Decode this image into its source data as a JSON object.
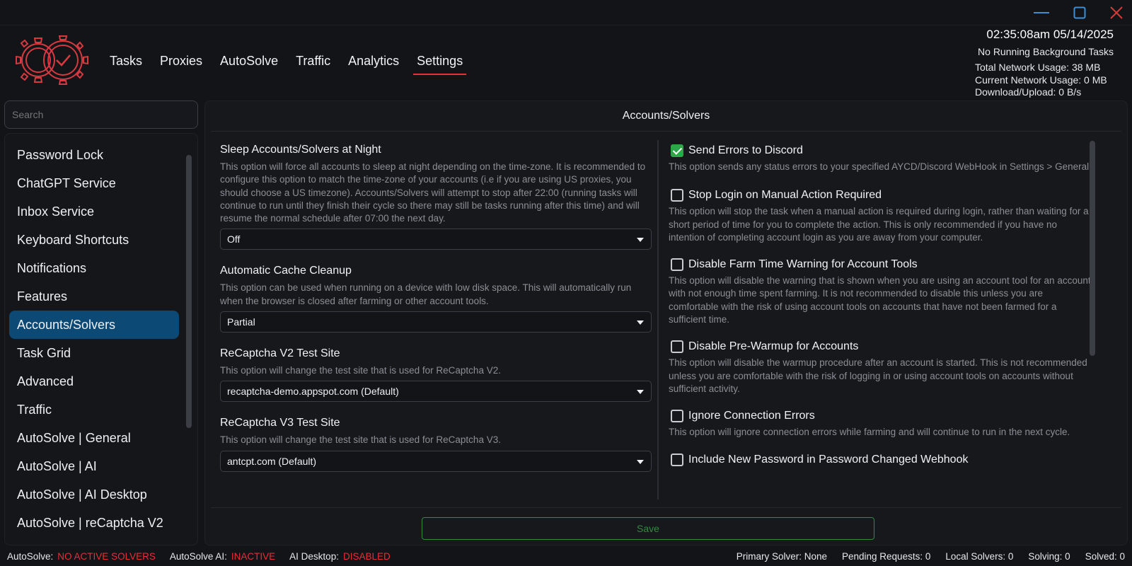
{
  "window": {
    "minimize_icon": "minimize-icon",
    "maximize_icon": "maximize-icon",
    "close_icon": "close-icon"
  },
  "nav": {
    "items": [
      "Tasks",
      "Proxies",
      "AutoSolve",
      "Traffic",
      "Analytics",
      "Settings"
    ],
    "active": "Settings"
  },
  "header": {
    "clock": "02:35:08am 05/14/2025",
    "background_tasks": "No Running Background Tasks",
    "total_network": "Total Network Usage:  38 MB",
    "current_network": "Current Network Usage: 0 MB",
    "download_upload": "Download/Upload: 0 B/s"
  },
  "sidebar": {
    "search_placeholder": "Search",
    "items": [
      "Password Lock",
      "ChatGPT Service",
      "Inbox Service",
      "Keyboard Shortcuts",
      "Notifications",
      "Features",
      "Accounts/Solvers",
      "Task Grid",
      "Advanced",
      "Traffic",
      "AutoSolve | General",
      "AutoSolve | AI",
      "AutoSolve | AI Desktop",
      "AutoSolve | reCaptcha V2"
    ],
    "active": "Accounts/Solvers"
  },
  "panel": {
    "title": "Accounts/Solvers",
    "left_settings": [
      {
        "title": "Sleep Accounts/Solvers at Night",
        "desc": "This option will force all accounts to sleep at night depending on the time-zone. It is recommended to configure this option to match the time-zone of your accounts (i.e if you are using US proxies, you should choose a US timezone). Accounts/Solvers will attempt to stop after 22:00 (running tasks will continue to run until they finish their cycle so there may still be tasks running after this time) and will resume the normal schedule after 07:00 the next day.",
        "value": "Off"
      },
      {
        "title": "Automatic Cache Cleanup",
        "desc": "This option can be used when running on a device with low disk space. This will automatically run when the browser is closed after farming or other account tools.",
        "value": "Partial"
      },
      {
        "title": "ReCaptcha V2 Test Site",
        "desc": "This option will change the test site that is used for ReCaptcha V2.",
        "value": "recaptcha-demo.appspot.com (Default)"
      },
      {
        "title": "ReCaptcha V3 Test Site",
        "desc": "This option will change the test site that is used for ReCaptcha V3.",
        "value": "antcpt.com (Default)"
      }
    ],
    "right_settings": [
      {
        "title": "Send Errors to Discord",
        "checked": true,
        "desc": "This option sends any status errors to your specified AYCD/Discord WebHook in Settings > General."
      },
      {
        "title": "Stop Login on Manual Action Required",
        "checked": false,
        "desc": "This option will stop the task when a manual action is required during login, rather than waiting for a short period of time for you to complete the action. This is only recommended if you have no intention of completing account login as you are away from your computer."
      },
      {
        "title": "Disable Farm Time Warning for Account Tools",
        "checked": false,
        "desc": "This option will disable the warning that is shown when you are using an account tool for an account with not enough time spent farming. It is not recommended to disable this unless you are comfortable with the risk of using account tools on accounts that have not been farmed for a sufficient time."
      },
      {
        "title": "Disable Pre-Warmup for Accounts",
        "checked": false,
        "desc": "This option will disable the warmup procedure after an account is started. This is not recommended unless you are comfortable with the risk of logging in or using account tools on accounts without sufficient activity."
      },
      {
        "title": "Ignore Connection Errors",
        "checked": false,
        "desc": "This option will ignore connection errors while farming and will continue to run in the next cycle."
      },
      {
        "title": "Include New Password in Password Changed Webhook",
        "checked": false,
        "desc": ""
      }
    ],
    "save_label": "Save"
  },
  "statusbar": {
    "autosolve_label": "AutoSolve:",
    "autosolve_value": "NO ACTIVE SOLVERS",
    "autosolve_ai_label": "AutoSolve AI:",
    "autosolve_ai_value": "INACTIVE",
    "ai_desktop_label": "AI Desktop:",
    "ai_desktop_value": "DISABLED",
    "primary_solver": "Primary Solver: None",
    "pending_requests": "Pending Requests: 0",
    "local_solvers": "Local Solvers: 0",
    "solving": "Solving: 0",
    "solved": "Solved: 0"
  },
  "colors": {
    "accent_red": "#e5323b",
    "active_blue": "#0c4a75",
    "check_green": "#2ba84a",
    "save_green": "#2e8d3f"
  }
}
